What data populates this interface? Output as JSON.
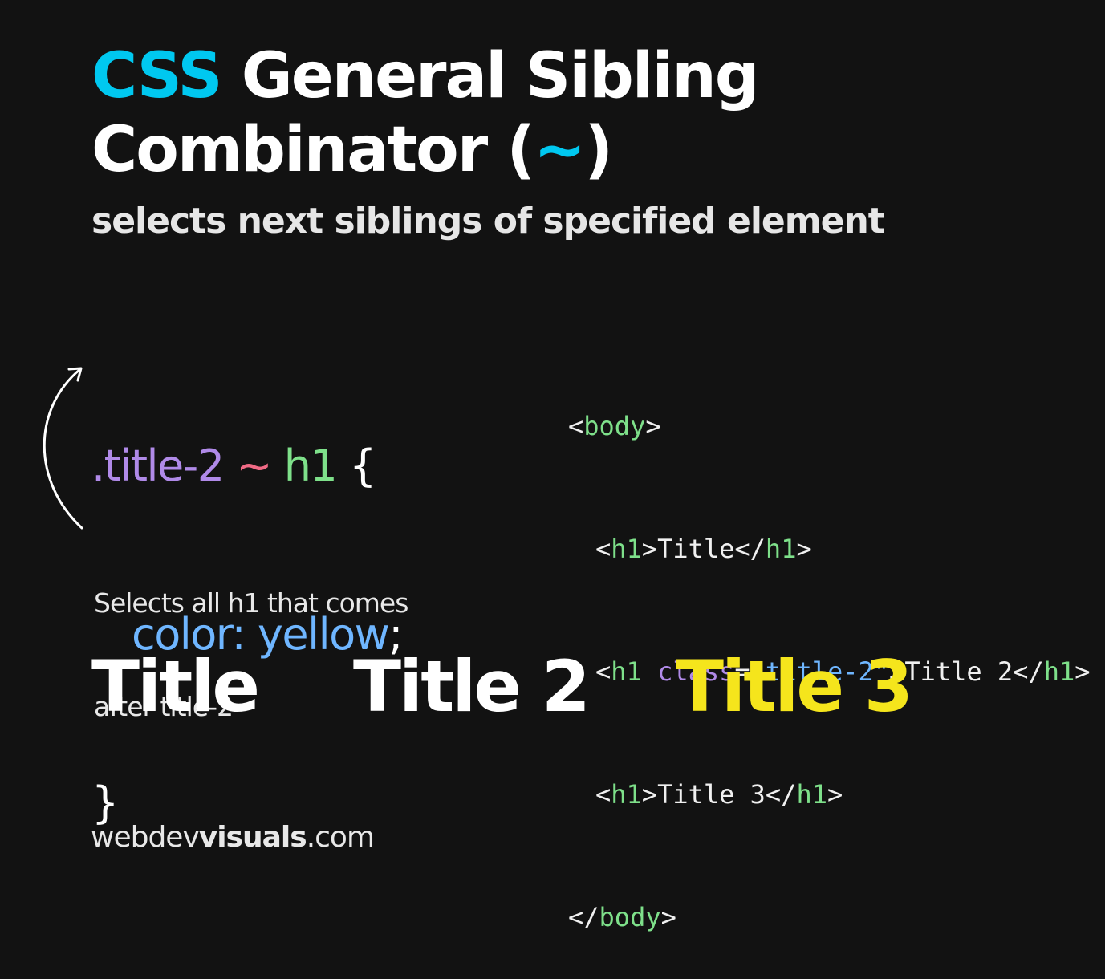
{
  "header": {
    "title_accent": "CSS",
    "title_line1_rest": " General Sibling",
    "title_line2_start": "Combinator (",
    "title_line2_symbol": "~",
    "title_line2_end": ")",
    "subtitle": "selects next siblings of specified element"
  },
  "css_code": {
    "selector_class": ".title-2",
    "combinator": "~",
    "selector_tag": "h1",
    "open_brace": "{",
    "property": "color:",
    "value": "yellow",
    "semicolon": ";",
    "close_brace": "}"
  },
  "annotation": {
    "line1": "Selects all h1 that comes",
    "line2": "after title-2"
  },
  "html_code": {
    "line1": {
      "open": "<",
      "tag": "body",
      "close": ">"
    },
    "line2": {
      "open": "<",
      "tag": "h1",
      "mid": ">Title</",
      "tag2": "h1",
      "close": ">"
    },
    "line3": {
      "open": "<",
      "tag": "h1",
      "attr": " class",
      "eq": "=",
      "str": "\"title-2\"",
      "mid": ">Title 2</",
      "tag2": "h1",
      "close": ">"
    },
    "line4": {
      "open": "<",
      "tag": "h1",
      "mid": ">Title 3</",
      "tag2": "h1",
      "close": ">"
    },
    "line5": {
      "open": "</",
      "tag": "body",
      "close": ">"
    }
  },
  "results": {
    "title1": "Title",
    "title2": "Title 2",
    "title3": "Title 3",
    "title3_color": "#f5e51c"
  },
  "footer": {
    "prefix": "webdev",
    "bold": "visuals",
    "suffix": ".com"
  },
  "colors": {
    "background": "#121212",
    "accent_cyan": "#00c8f0",
    "highlight_yellow": "#f5e51c"
  }
}
